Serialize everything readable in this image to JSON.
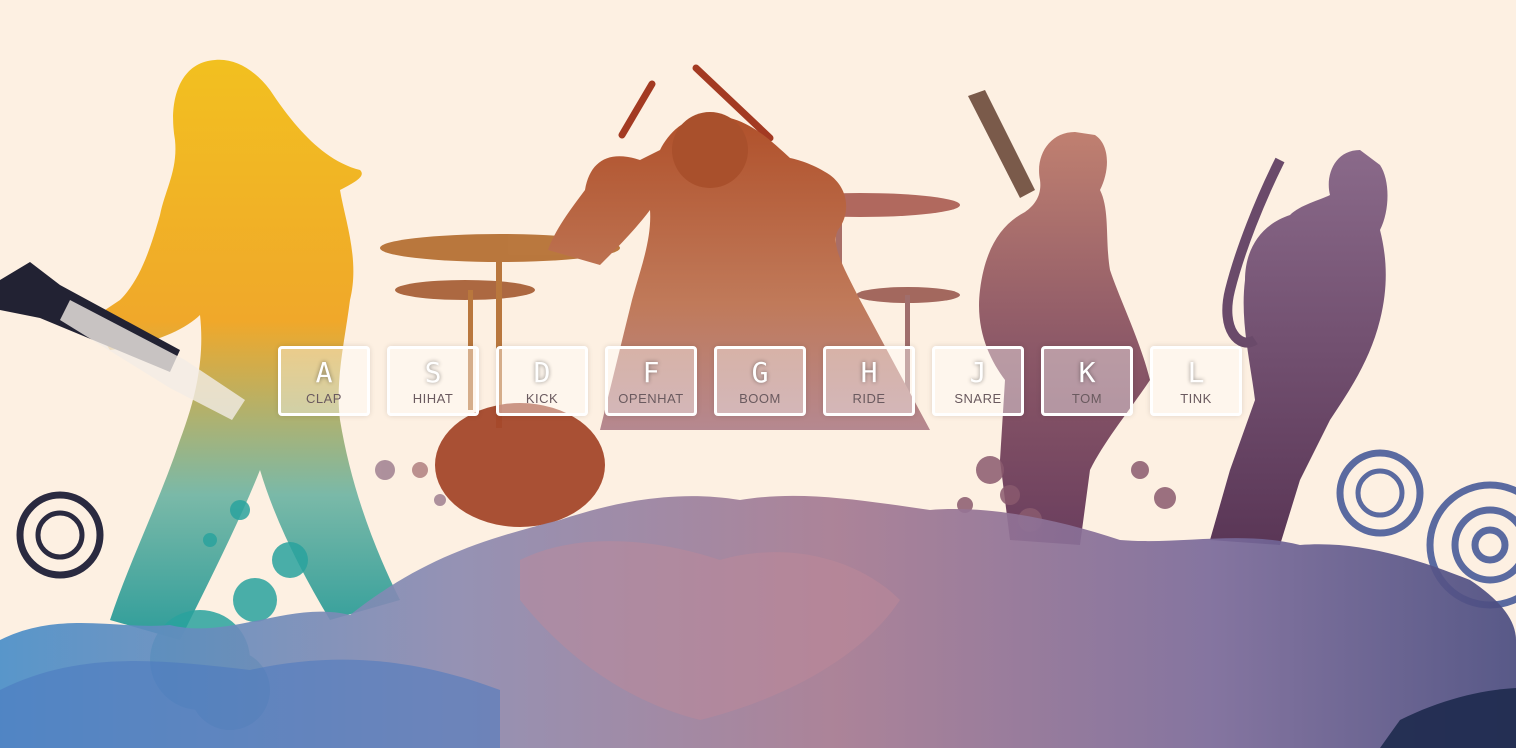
{
  "colors": {
    "background": "#fdf0e2",
    "key_border": "#ffffff",
    "key_text": "#ffffff",
    "sound_text": "#6a5a5f"
  },
  "drum_kit": {
    "keys": [
      {
        "key": "A",
        "sound": "CLAP"
      },
      {
        "key": "S",
        "sound": "HIHAT"
      },
      {
        "key": "D",
        "sound": "KICK"
      },
      {
        "key": "F",
        "sound": "OPENHAT"
      },
      {
        "key": "G",
        "sound": "BOOM"
      },
      {
        "key": "H",
        "sound": "RIDE"
      },
      {
        "key": "J",
        "sound": "SNARE"
      },
      {
        "key": "K",
        "sound": "TOM"
      },
      {
        "key": "L",
        "sound": "TINK"
      }
    ]
  }
}
